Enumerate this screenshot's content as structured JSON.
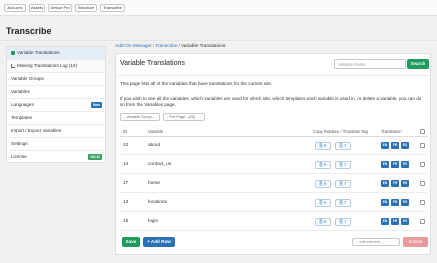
{
  "topnav": {
    "items": [
      "Add-ons",
      "Assets",
      "Detour Pro",
      "Structure",
      "Transcribe"
    ]
  },
  "page_title": "Transcribe",
  "sidebar": {
    "items": [
      {
        "label": "Variable Translations",
        "icon": "folder-open-icon",
        "active": true
      },
      {
        "label": "Missing Translations Log (10)",
        "icon": "list-icon",
        "sub": true
      },
      {
        "label": "Variable Groups"
      },
      {
        "label": "Variables"
      },
      {
        "label": "Languages",
        "badge": "New",
        "badge_color": "#2a72b5"
      },
      {
        "label": "Templates"
      },
      {
        "label": "Import / Export Variables"
      },
      {
        "label": "Settings"
      },
      {
        "label": "License",
        "badge": "VALID",
        "badge_color": "#3aa25e"
      }
    ]
  },
  "breadcrumb": {
    "items": [
      "Add-On Manager",
      "Transcribe",
      "Variable Translations"
    ],
    "separator": "/"
  },
  "panel": {
    "title": "Variable Translations",
    "search_placeholder": "Variable Name",
    "search_button": "Search",
    "intro": "This page lists all of the variables that have translations for the current site.",
    "intro2": "If you wish to see all the variables, which variables are used for which site, which templates each variable is used in, or delete a variable, you can do so from the Variables page."
  },
  "filters": {
    "group": "- Variable Group -",
    "per_page": "- Per Page - (25)"
  },
  "table": {
    "headers": {
      "id": "ID",
      "variable": "Variable",
      "copy": "Copy Replace / Translate Tag",
      "translation": "Translation"
    },
    "rows": [
      {
        "id": "12",
        "variable": "about"
      },
      {
        "id": "14",
        "variable": "contact_us"
      },
      {
        "id": "17",
        "variable": "home"
      },
      {
        "id": "13",
        "variable": "locations"
      },
      {
        "id": "15",
        "variable": "login"
      }
    ],
    "copy_replace_label": "R",
    "copy_translate_label": "T",
    "languages": [
      "EN",
      "FR",
      "ES"
    ]
  },
  "footer": {
    "save": "Save",
    "add_row": "+ Add Row",
    "with_selected": "-- with selected --",
    "submit": "Submit"
  },
  "colors": {
    "green": "#1f9b5b",
    "blue": "#2a72b5",
    "submit_disabled": "#e89a9a"
  }
}
